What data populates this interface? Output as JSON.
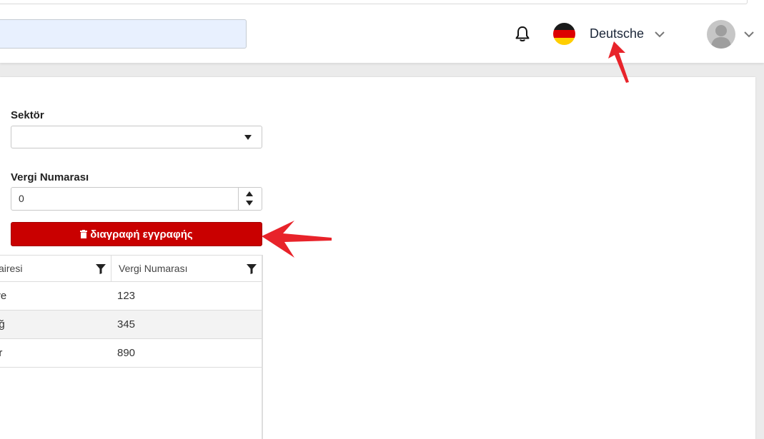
{
  "header": {
    "search": {
      "value": "",
      "placeholder": ""
    },
    "language": {
      "label": "Deutsche",
      "flag_colors": [
        "#1a1a1a",
        "#dd0000",
        "#ffce00"
      ]
    }
  },
  "form": {
    "sector": {
      "label": "Sektör",
      "value": ""
    },
    "tax_number": {
      "label": "Vergi Numarası",
      "value": "0"
    },
    "delete_button": {
      "label": "διαγραφή εγγραφής",
      "color": "#c90000"
    }
  },
  "grid": {
    "columns": [
      "airesi",
      "Vergi Numarası"
    ],
    "rows": [
      {
        "c1": "iye",
        "c2": "123"
      },
      {
        "c1": "ağ",
        "c2": "345"
      },
      {
        "c1": "ar",
        "c2": "890"
      }
    ]
  },
  "annotations": {
    "arrow_color": "#e8232a"
  }
}
